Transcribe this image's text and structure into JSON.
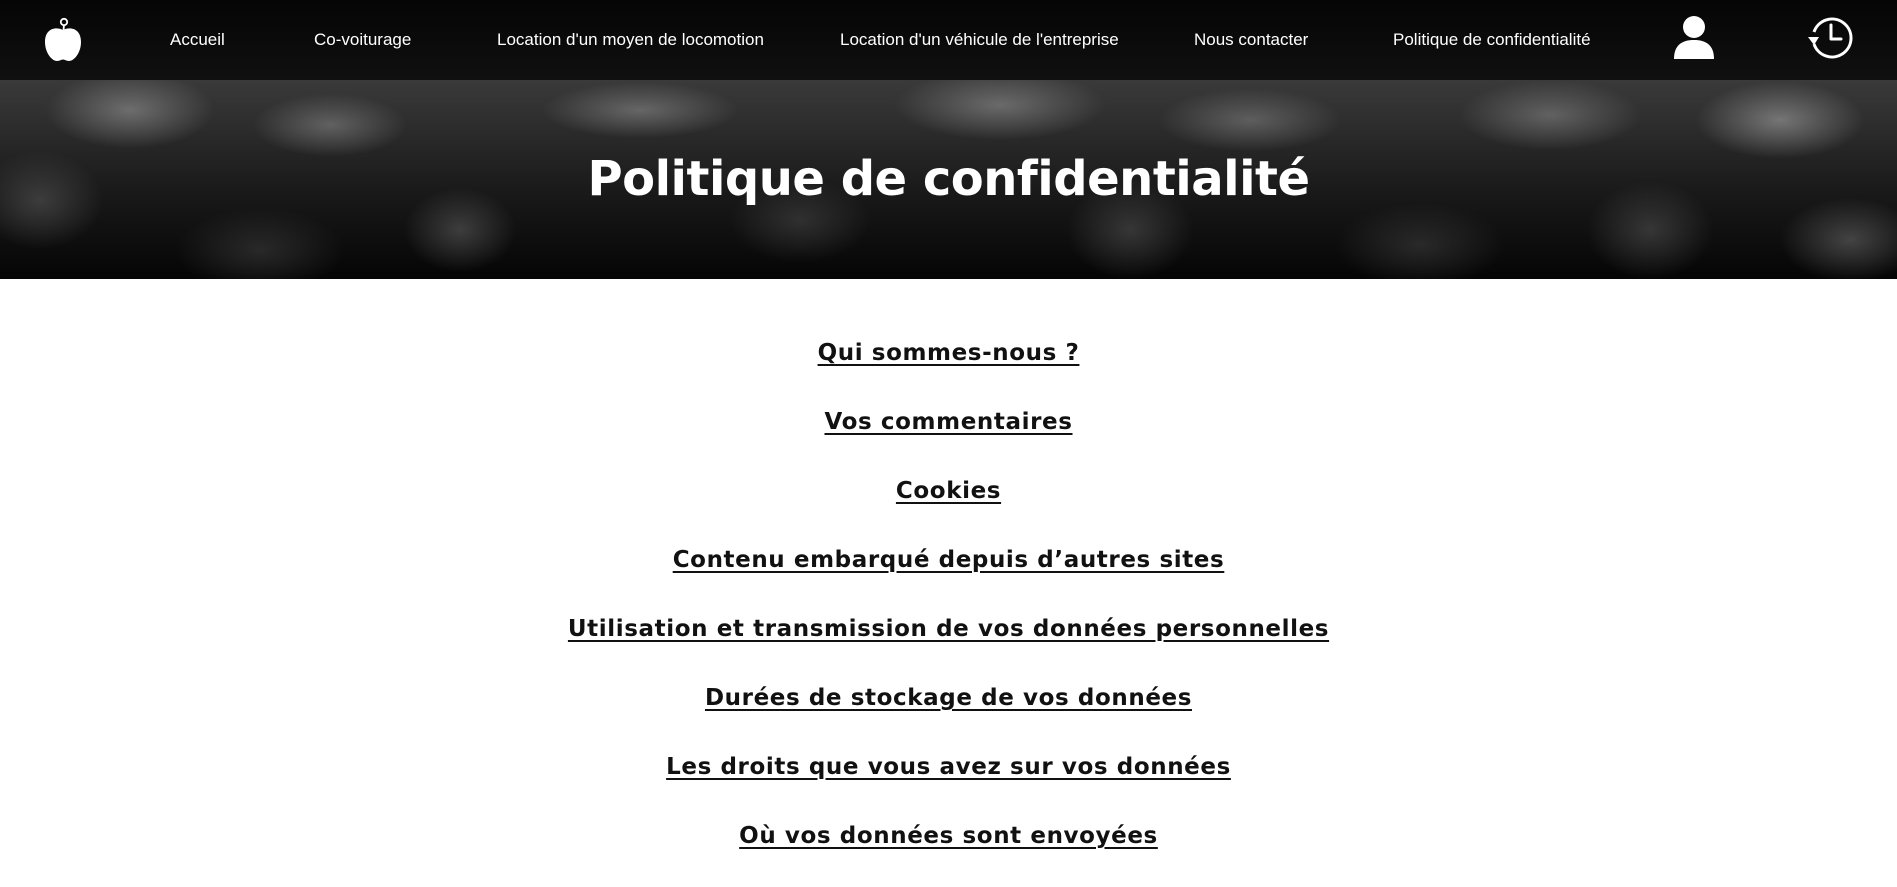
{
  "nav": {
    "logo_icon": "apple-logo-icon",
    "links": [
      {
        "label": "Accueil"
      },
      {
        "label": "Co-voiturage"
      },
      {
        "label": "Location d'un moyen de locomotion"
      },
      {
        "label": "Location d'un véhicule de l'entreprise"
      },
      {
        "label": "Nous contacter"
      },
      {
        "label": "Politique de confidentialité"
      }
    ],
    "account_icon": "user-icon",
    "history_icon": "history-clock-icon"
  },
  "hero": {
    "title": "Politique de confidentialité"
  },
  "toc": {
    "items": [
      {
        "label": "Qui sommes-nous ?"
      },
      {
        "label": "Vos commentaires"
      },
      {
        "label": "Cookies"
      },
      {
        "label": "Contenu embarqué depuis d’autres sites"
      },
      {
        "label": "Utilisation et transmission de vos données personnelles"
      },
      {
        "label": "Durées de stockage de vos données"
      },
      {
        "label": "Les droits que vous avez sur vos données"
      },
      {
        "label": "Où vos données sont envoyées"
      }
    ]
  },
  "colors": {
    "nav_background": "#0a0a0a",
    "nav_text": "#ffffff",
    "link_text": "#111111",
    "page_background": "#ffffff"
  }
}
